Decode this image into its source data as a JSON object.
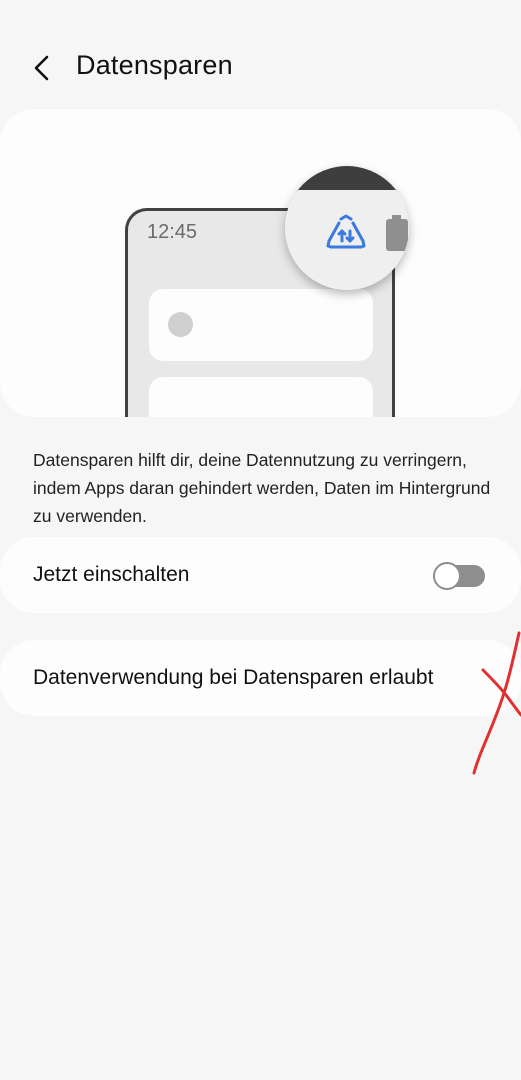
{
  "header": {
    "title": "Datensparen",
    "back_icon": "chevron-left-icon"
  },
  "illustration": {
    "phone_time": "12:45",
    "data_saver_icon": "data-saver-icon",
    "battery_icon": "battery-icon",
    "icon_color": "#3b7ae0"
  },
  "description": "Datensparen hilft dir, deine Datennutzung zu verringern, indem Apps daran gehindert werden, Daten im Hintergrund zu verwenden.",
  "settings": {
    "toggle_label": "Jetzt einschalten",
    "toggle_state": "off",
    "allowed_label": "Datenverwendung bei Datensparen erlaubt"
  },
  "colors": {
    "background": "#f6f6f6",
    "card": "#fdfdfd",
    "toggle_off": "#8e8e8e",
    "annotation": "#e0302f"
  }
}
